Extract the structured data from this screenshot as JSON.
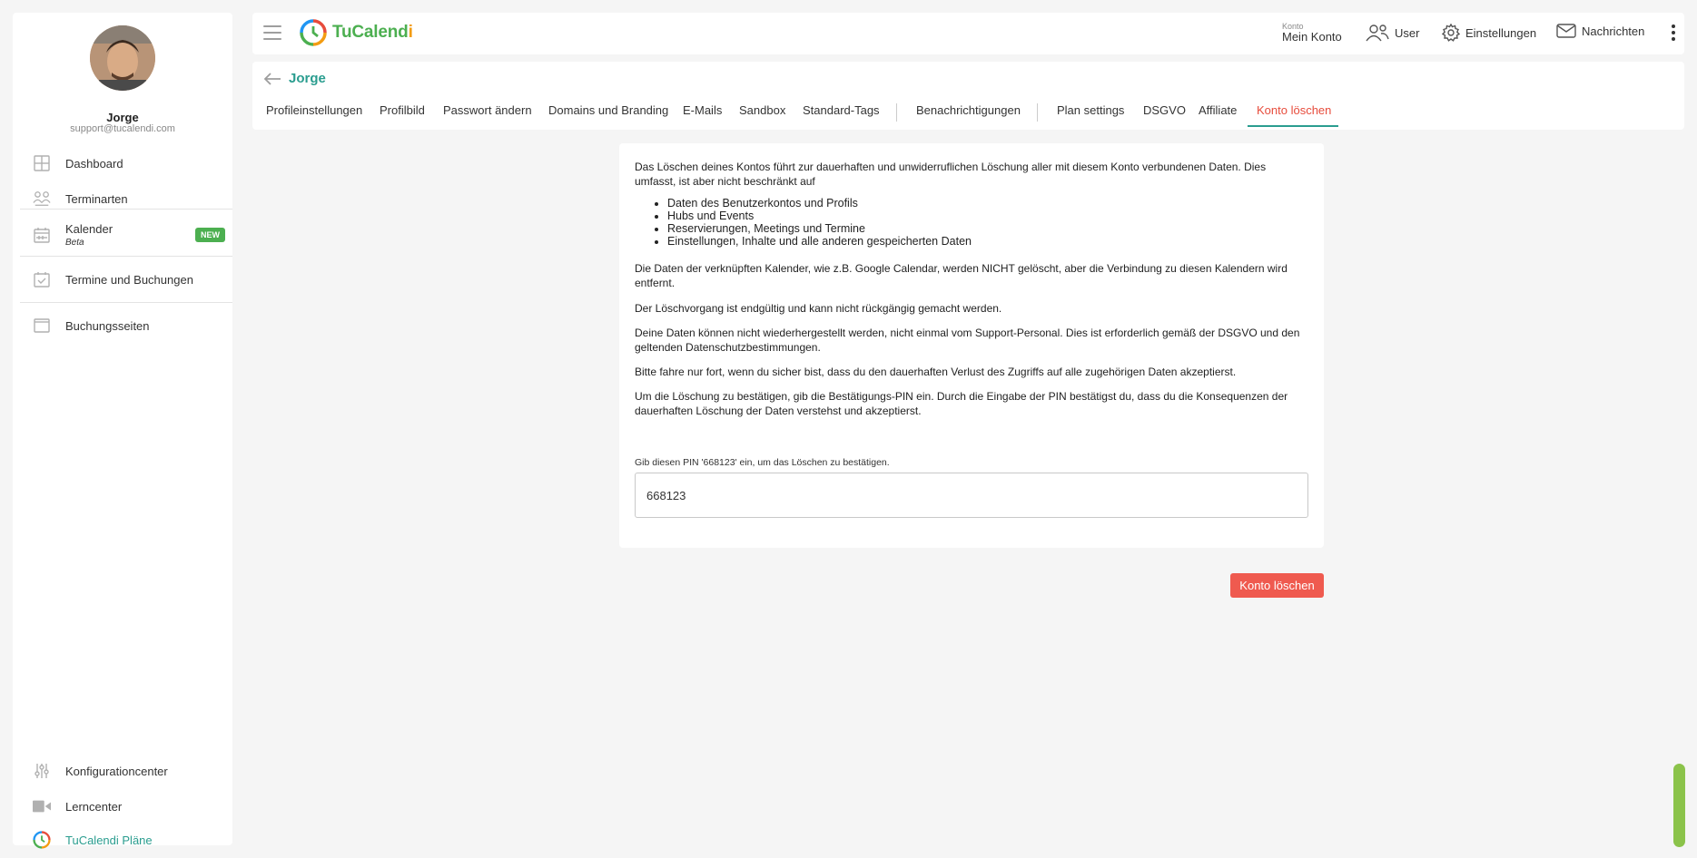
{
  "user": {
    "name": "Jorge",
    "email": "support@tucalendi.com"
  },
  "sidebar": {
    "items": [
      {
        "label": "Dashboard",
        "icon": "grid-icon"
      },
      {
        "label": "Terminarten",
        "icon": "people-icon"
      },
      {
        "label": "Kalender",
        "icon": "calendar-icon",
        "badge": "NEW",
        "sub": "Beta"
      },
      {
        "label": "Termine und Buchungen",
        "icon": "calendar-check-icon"
      },
      {
        "label": "Buchungsseiten",
        "icon": "browser-icon"
      }
    ],
    "bottom_items": [
      {
        "label": "Konfigurationcenter",
        "icon": "sliders-icon"
      },
      {
        "label": "Lerncenter",
        "icon": "video-icon"
      },
      {
        "label": "TuCalendi Pläne",
        "icon": "tucalendi-logo-icon"
      }
    ]
  },
  "header": {
    "logo_part1": "TuCalend",
    "logo_part2": "i",
    "account_small": "Konto",
    "account_label": "Mein Konto",
    "user_label": "User",
    "settings_label": "Einstellungen",
    "messages_label": "Nachrichten"
  },
  "page": {
    "title": "Jorge",
    "tabs": [
      "Profileinstellungen",
      "Profilbild",
      "Passwort ändern",
      "Domains und Branding",
      "E-Mails",
      "Sandbox",
      "Standard-Tags",
      "Benachrichtigungen",
      "Plan settings",
      "DSGVO",
      "Affiliate",
      "Konto löschen"
    ],
    "active_tab": "Konto löschen"
  },
  "content": {
    "intro": "Das Löschen deines Kontos führt zur dauerhaften und unwiderruflichen Löschung aller mit diesem Konto verbundenen Daten. Dies umfasst, ist aber nicht beschränkt auf",
    "list": [
      "Daten des Benutzerkontos und Profils",
      "Hubs und Events",
      "Reservierungen, Meetings und Termine",
      "Einstellungen, Inhalte und alle anderen gespeicherten Daten"
    ],
    "para1": "Die Daten der verknüpften Kalender, wie z.B. Google Calendar, werden NICHT gelöscht, aber die Verbindung zu diesen Kalendern wird entfernt.",
    "para2": "Der Löschvorgang ist endgültig und kann nicht rückgängig gemacht werden.",
    "para3": "Deine Daten können nicht wiederhergestellt werden, nicht einmal vom Support-Personal. Dies ist erforderlich gemäß der DSGVO und den geltenden Datenschutzbestimmungen.",
    "para4": "Bitte fahre nur fort, wenn du sicher bist, dass du den dauerhaften Verlust des Zugriffs auf alle zugehörigen Daten akzeptierst.",
    "para5": "Um die Löschung zu bestätigen, gib die Bestätigungs-PIN ein. Durch die Eingabe der PIN bestätigst du, dass du die Konsequenzen der dauerhaften Löschung der Daten verstehst und akzeptierst.",
    "pin_label": "Gib diesen PIN '668123' ein, um das Löschen zu bestätigen.",
    "pin_value": "668123"
  },
  "actions": {
    "delete_label": "Konto löschen"
  },
  "colors": {
    "accent": "#2a9d8f",
    "danger": "#ef5a4f",
    "active_tab": "#e74c3c",
    "badge": "#4caf50"
  }
}
